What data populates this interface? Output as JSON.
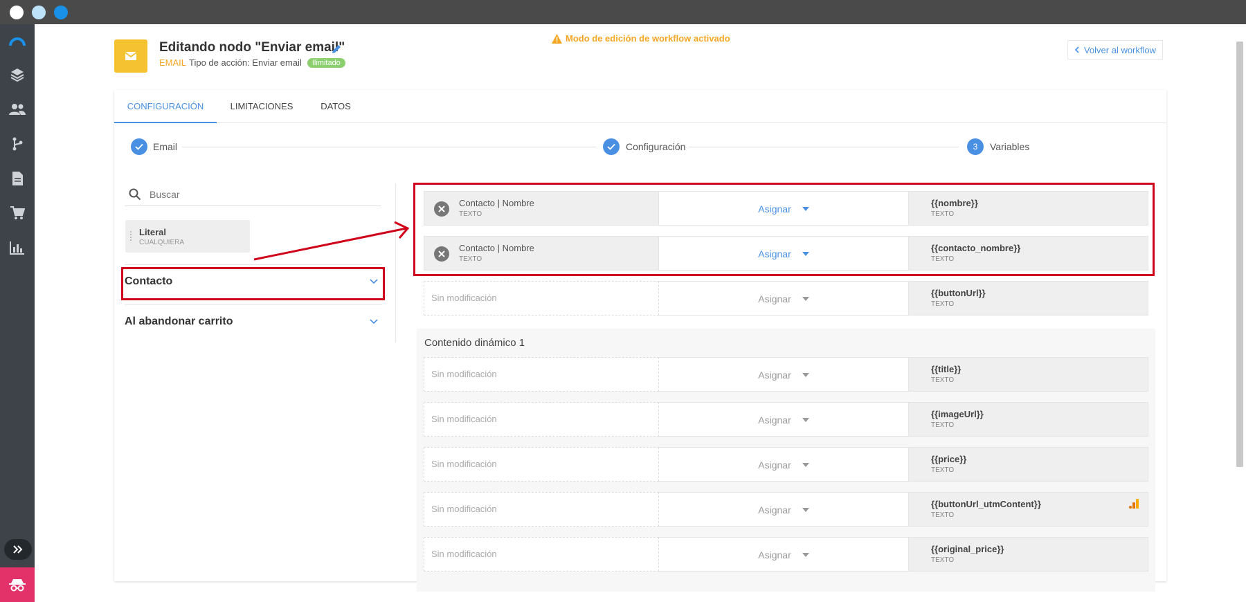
{
  "window": {
    "controls": [
      "close-dot",
      "minimize-dot",
      "maximize-dot"
    ]
  },
  "sidebar": {
    "items": [
      {
        "icon": "logo-icon"
      },
      {
        "icon": "layers-icon"
      },
      {
        "icon": "users-icon"
      },
      {
        "icon": "workflow-icon"
      },
      {
        "icon": "document-icon"
      },
      {
        "icon": "cart-icon"
      },
      {
        "icon": "chart-icon"
      }
    ],
    "expand_icon": "double-chevron-right-icon",
    "bottom_icon": "incognito-icon"
  },
  "header": {
    "title": "Editando nodo \"Enviar email\"",
    "channel": "EMAIL",
    "action_label": "Tipo de acción: Enviar email",
    "badge": "Ilimitado",
    "warning": "Modo de edición de workflow activado",
    "back_label": "Volver al workflow"
  },
  "tabs": [
    {
      "label": "CONFIGURACIÓN",
      "active": true
    },
    {
      "label": "LIMITACIONES",
      "active": false
    },
    {
      "label": "DATOS",
      "active": false
    }
  ],
  "stepper": [
    {
      "label": "Email",
      "state": "done",
      "marker": ""
    },
    {
      "label": "Configuración",
      "state": "done",
      "marker": ""
    },
    {
      "label": "Variables",
      "state": "current",
      "marker": "3"
    }
  ],
  "left_panel": {
    "search_placeholder": "Buscar",
    "literal": {
      "name": "Literal",
      "type": "CUALQUIERA"
    },
    "groups": [
      "Contacto",
      "Al abandonar carrito"
    ]
  },
  "mappings": [
    {
      "source": "Contacto | Nombre",
      "source_type": "TEXTO",
      "assign": "Asignar",
      "variable": "{{nombre}}",
      "variable_type": "TEXTO"
    },
    {
      "source": "Contacto | Nombre",
      "source_type": "TEXTO",
      "assign": "Asignar",
      "variable": "{{contacto_nombre}}",
      "variable_type": "TEXTO"
    },
    {
      "source": "Sin modificación",
      "source_type": "",
      "assign": "Asignar",
      "variable": "{{buttonUrl}}",
      "variable_type": "TEXTO"
    }
  ],
  "dynamic_section": {
    "title": "Contenido dinámico 1",
    "rows": [
      {
        "source": "Sin modificación",
        "assign": "Asignar",
        "variable": "{{title}}",
        "variable_type": "TEXTO"
      },
      {
        "source": "Sin modificación",
        "assign": "Asignar",
        "variable": "{{imageUrl}}",
        "variable_type": "TEXTO"
      },
      {
        "source": "Sin modificación",
        "assign": "Asignar",
        "variable": "{{price}}",
        "variable_type": "TEXTO"
      },
      {
        "source": "Sin modificación",
        "assign": "Asignar",
        "variable": "{{buttonUrl_utmContent}}",
        "variable_type": "TEXTO",
        "extra_icon": "analytics-icon"
      },
      {
        "source": "Sin modificación",
        "assign": "Asignar",
        "variable": "{{original_price}}",
        "variable_type": "TEXTO"
      }
    ]
  },
  "colors": {
    "accent": "#4a90e2",
    "warning": "#f5a623",
    "highlight": "#d0021b",
    "badge": "#8ccf6f",
    "node": "#f5c331"
  }
}
